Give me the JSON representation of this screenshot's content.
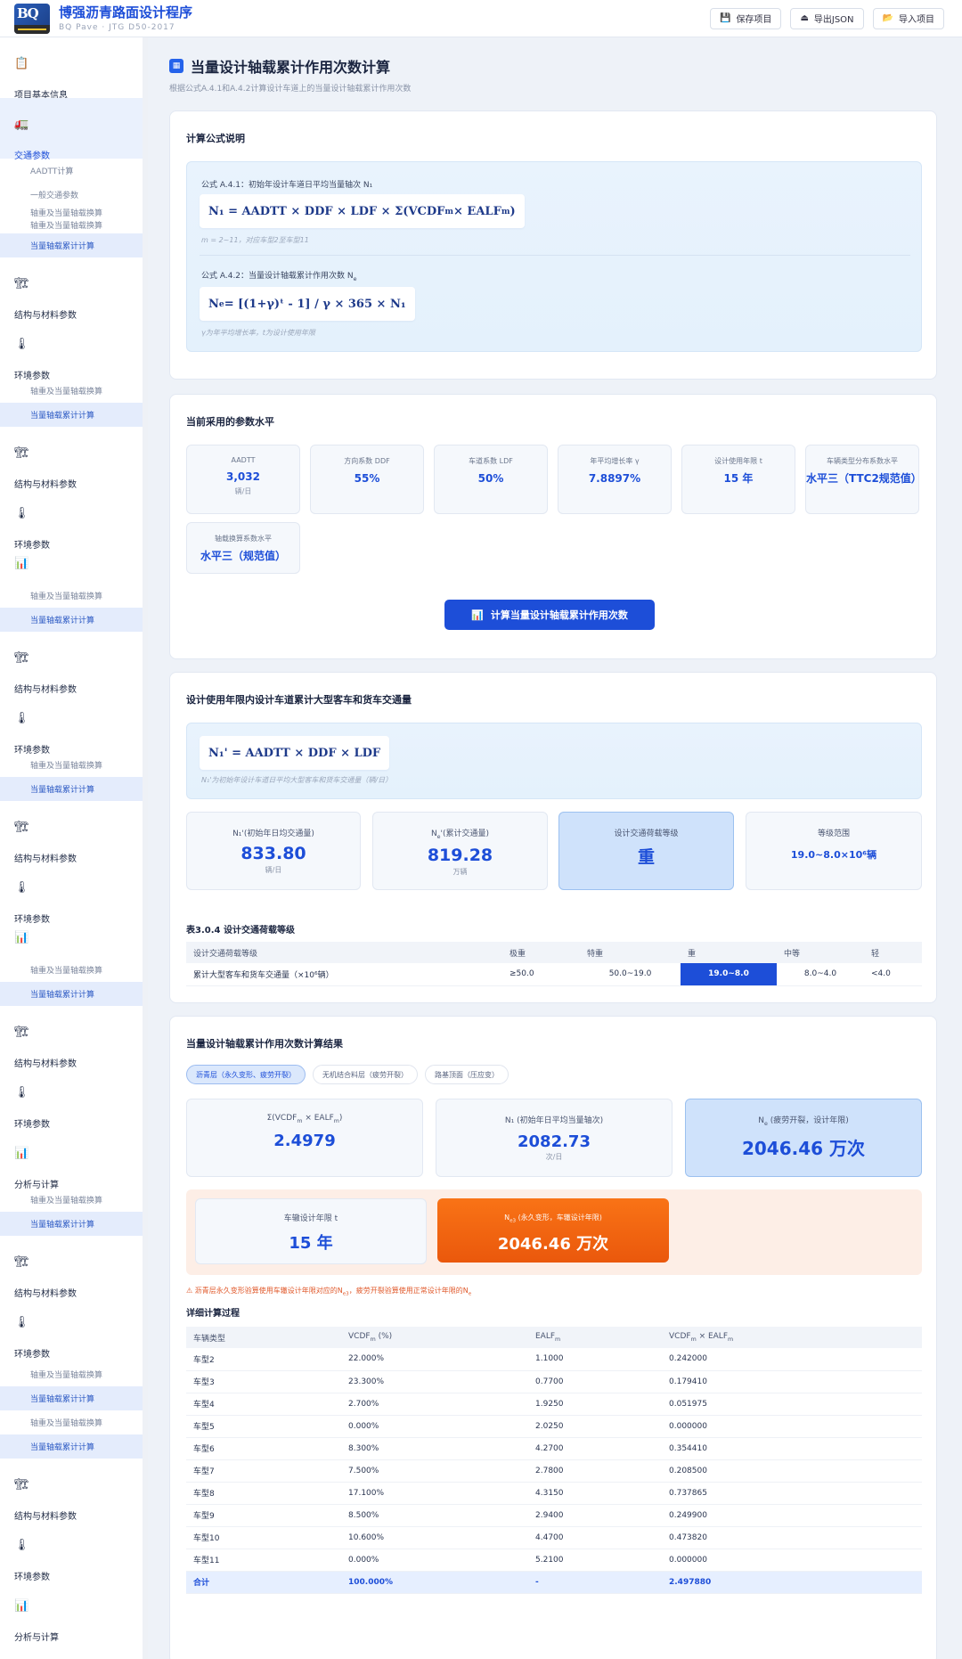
{
  "header": {
    "logo_text": "BQ",
    "title": "博强沥青路面设计程序",
    "subtitle": "BQ Pave · JTG D50-2017",
    "actions": [
      {
        "label": "保存项目",
        "icon": "save-icon"
      },
      {
        "label": "导出JSON",
        "icon": "export-icon"
      },
      {
        "label": "导入项目",
        "icon": "folder-icon"
      }
    ]
  },
  "sidebar": {
    "project_info": "项目基本信息",
    "traffic": "交通参数",
    "sub_aadtt": "AADTT计算",
    "sub_general": "一般交通参数",
    "sub_axle": "轴重及当量轴载换算",
    "sub_esal": "当量轴载累计计算",
    "structure": "结构与材料参数",
    "environment": "环境参数",
    "analysis": "分析与计算"
  },
  "page": {
    "title": "当量设计轴载累计作用次数计算",
    "description": "根据公式A.4.1和A.4.2计算设计车道上的当量设计轴载累计作用次数"
  },
  "formula_card": {
    "title": "计算公式说明",
    "f1_caption": "公式 A.4.1：初始年设计车道日平均当量轴次 N₁",
    "f1_eq_pre": "N₁ = AADTT × DDF × LDF × Σ(VCDF",
    "f1_eq_sub1": "m",
    "f1_eq_mid": " × EALF",
    "f1_eq_sub2": "m",
    "f1_eq_post": ")",
    "f1_note": "m = 2~11，对应车型2至车型11",
    "f2_caption_pre": "公式 A.4.2：当量设计轴载累计作用次数 N",
    "f2_caption_sub": "e",
    "f2_eq_pre": "N",
    "f2_eq_sub": "e",
    "f2_eq_post": " = [(1+γ)ᵗ - 1] / γ × 365 × N₁",
    "f2_note": "γ为年平均增长率，t为设计使用年限"
  },
  "params_card": {
    "title": "当前采用的参数水平",
    "items": [
      {
        "label": "AADTT",
        "value": "3,032",
        "unit": "辆/日"
      },
      {
        "label": "方向系数 DDF",
        "value": "55%",
        "unit": ""
      },
      {
        "label": "车道系数 LDF",
        "value": "50%",
        "unit": ""
      },
      {
        "label": "年平均增长率 γ",
        "value": "7.8897%",
        "unit": ""
      },
      {
        "label": "设计使用年限 t",
        "value": "15 年",
        "unit": ""
      },
      {
        "label": "车辆类型分布系数水平",
        "value": "水平三（TTC2规范值）",
        "unit": ""
      },
      {
        "label": "轴载换算系数水平",
        "value": "水平三（规范值）",
        "unit": ""
      }
    ],
    "button": "计算当量设计轴载累计作用次数",
    "button_icon": "chart-icon"
  },
  "traffic_card": {
    "title": "设计使用年限内设计车道累计大型客车和货车交通量",
    "eq": "N₁' = AADTT × DDF × LDF",
    "note": "N₁'为初始年设计车道日平均大型客车和货车交通量（辆/日）",
    "stats": [
      {
        "label": "N₁'(初始年日均交通量)",
        "value": "833.80",
        "unit": "辆/日"
      },
      {
        "label_pre": "N",
        "label_sub": "e",
        "label_post": "'(累计交通量)",
        "value": "819.28",
        "unit": "万辆"
      },
      {
        "label": "设计交通荷载等级",
        "value": "重",
        "unit": ""
      },
      {
        "label": "等级范围",
        "value": "19.0~8.0×10⁶辆",
        "unit": ""
      }
    ],
    "table_title": "表3.0.4 设计交通荷载等级",
    "table_headers": [
      "设计交通荷载等级",
      "极重",
      "特重",
      "重",
      "中等",
      "轻"
    ],
    "table_row": [
      "累计大型客车和货车交通量（×10⁶辆）",
      "≥50.0",
      "50.0~19.0",
      "19.0~8.0",
      "8.0~4.0",
      "<4.0"
    ]
  },
  "result_card": {
    "title": "当量设计轴载累计作用次数计算结果",
    "tabs": [
      "沥青层（永久变形、疲劳开裂）",
      "无机结合料层（疲劳开裂）",
      "路基顶面（压应变）"
    ],
    "r1_label_pre": "Σ(VCDF",
    "r1_label_sub1": "m",
    "r1_label_mid": " × EALF",
    "r1_label_sub2": "m",
    "r1_label_post": ")",
    "r1_value": "2.4979",
    "r2_label": "N₁ (初始年日平均当量轴次)",
    "r2_value": "2082.73",
    "r2_unit": "次/日",
    "r3_label_pre": "N",
    "r3_label_sub": "e",
    "r3_label_post": " (疲劳开裂，设计年限)",
    "r3_value": "2046.46 万次",
    "rut_label": "车辙设计年限 t",
    "rut_value": "15 年",
    "ne3_label_pre": "N",
    "ne3_label_sub": "e3",
    "ne3_label_post": " (永久变形，车辙设计年限)",
    "ne3_value": "2046.46 万次",
    "warning_pre": "⚠ 沥青层永久变形验算使用车辙设计年限对应的N",
    "warning_sub1": "e3",
    "warning_mid": "，疲劳开裂验算使用正常设计年限的N",
    "warning_sub2": "e",
    "detail_title": "详细计算过程",
    "detail_headers": {
      "c1": "车辆类型",
      "c2_pre": "VCDF",
      "c2_sub": "m",
      "c2_post": " (%)",
      "c3_pre": "EALF",
      "c3_sub": "m",
      "c4_pre": "VCDF",
      "c4_sub1": "m",
      "c4_mid": " × EALF",
      "c4_sub2": "m"
    },
    "rows": [
      [
        "车型2",
        "22.000%",
        "1.1000",
        "0.242000"
      ],
      [
        "车型3",
        "23.300%",
        "0.7700",
        "0.179410"
      ],
      [
        "车型4",
        "2.700%",
        "1.9250",
        "0.051975"
      ],
      [
        "车型5",
        "0.000%",
        "2.0250",
        "0.000000"
      ],
      [
        "车型6",
        "8.300%",
        "4.2700",
        "0.354410"
      ],
      [
        "车型7",
        "7.500%",
        "2.7800",
        "0.208500"
      ],
      [
        "车型8",
        "17.100%",
        "4.3150",
        "0.737865"
      ],
      [
        "车型9",
        "8.500%",
        "2.9400",
        "0.249900"
      ],
      [
        "车型10",
        "10.600%",
        "4.4700",
        "0.473820"
      ],
      [
        "车型11",
        "0.000%",
        "5.2100",
        "0.000000"
      ]
    ],
    "total": [
      "合计",
      "100.000%",
      "-",
      "2.497880"
    ]
  },
  "colors": {
    "accent": "#1d4ed8",
    "orange": "#ea580c",
    "highlight": "#cfe2fb"
  }
}
